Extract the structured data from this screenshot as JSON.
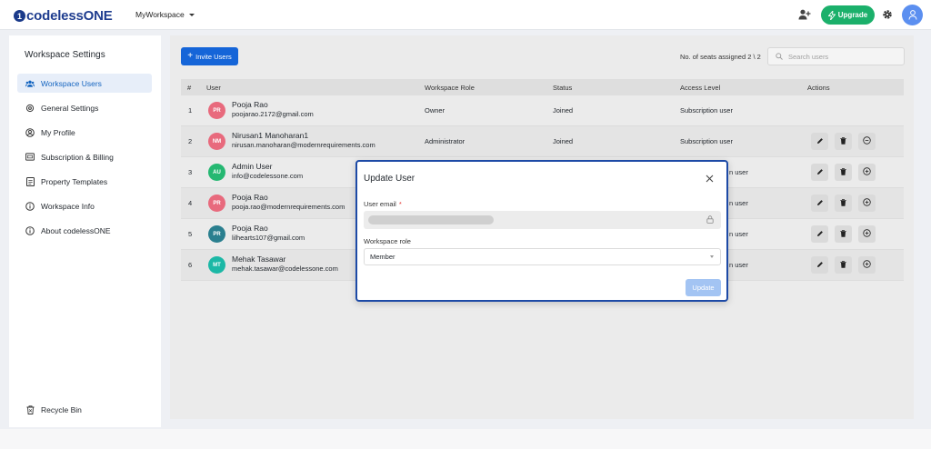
{
  "header": {
    "logo_mark": "1",
    "app_name": "codelessONE",
    "workspace": "MyWorkspace",
    "upgrade_label": "Upgrade",
    "icons": [
      "add-user-icon",
      "gear-icon",
      "user-icon",
      "lightning-icon"
    ],
    "colors": {
      "brand": "#1f3d8f",
      "upgrade": "#1bb06b",
      "avatar": "#5b8ff0"
    }
  },
  "sidebar": {
    "title": "Workspace Settings",
    "items": [
      {
        "label": "Workspace Users",
        "icon": "users-icon",
        "active": true
      },
      {
        "label": "General Settings",
        "icon": "gear-icon"
      },
      {
        "label": "My Profile",
        "icon": "user-circle-icon"
      },
      {
        "label": "Subscription & Billing",
        "icon": "billing-icon"
      },
      {
        "label": "Property Templates",
        "icon": "document-icon"
      },
      {
        "label": "Workspace Info",
        "icon": "info-icon"
      },
      {
        "label": "About codelessONE",
        "icon": "info-icon"
      }
    ],
    "recycle_label": "Recycle Bin"
  },
  "main": {
    "invite_label": "Invite Users",
    "seats_text": "No. of seats assigned 2 \\ 2",
    "search_placeholder": "Search users",
    "table": {
      "headers": [
        "#",
        "User",
        "Workspace Role",
        "Status",
        "Access Level",
        "Actions"
      ],
      "rows": [
        {
          "num": "1",
          "initials": "PR",
          "color": "#e86a7d",
          "name": "Pooja Rao",
          "email": "poojarao.2172@gmail.com",
          "role": "Owner",
          "status": "Joined",
          "access": "Subscription user",
          "actions": false
        },
        {
          "num": "2",
          "initials": "NM",
          "color": "#e86a7d",
          "name": "Nirusan1 Manoharan1",
          "email": "nirusan.manoharan@modernrequirements.com",
          "role": "Administrator",
          "status": "Joined",
          "access": "Subscription user",
          "actions": true,
          "third_icon": "minus-circle-icon"
        },
        {
          "num": "3",
          "initials": "AU",
          "color": "#25b872",
          "name": "Admin User",
          "email": "info@codelessone.com",
          "role": "",
          "status": "",
          "access": "n user",
          "actions": true,
          "third_icon": "plus-circle-icon"
        },
        {
          "num": "4",
          "initials": "PR",
          "color": "#e86a7d",
          "name": "Pooja Rao",
          "email": "pooja.rao@modernrequirements.com",
          "role": "",
          "status": "",
          "access": "n user",
          "actions": true,
          "third_icon": "plus-circle-icon"
        },
        {
          "num": "5",
          "initials": "PR",
          "color": "#2a7f8f",
          "name": "Pooja Rao",
          "email": "lilhearts107@gmail.com",
          "role": "",
          "status": "",
          "access": "n user",
          "actions": true,
          "third_icon": "plus-circle-icon"
        },
        {
          "num": "6",
          "initials": "MT",
          "color": "#1cb8a6",
          "name": "Mehak Tasawar",
          "email": "mehak.tasawar@codelessone.com",
          "role": "",
          "status": "",
          "access": "n user",
          "actions": true,
          "third_icon": "plus-circle-icon"
        }
      ]
    }
  },
  "modal": {
    "title": "Update User",
    "email_label": "User email",
    "required_mark": "*",
    "role_label": "Workspace role",
    "role_value": "Member",
    "update_label": "Update"
  }
}
